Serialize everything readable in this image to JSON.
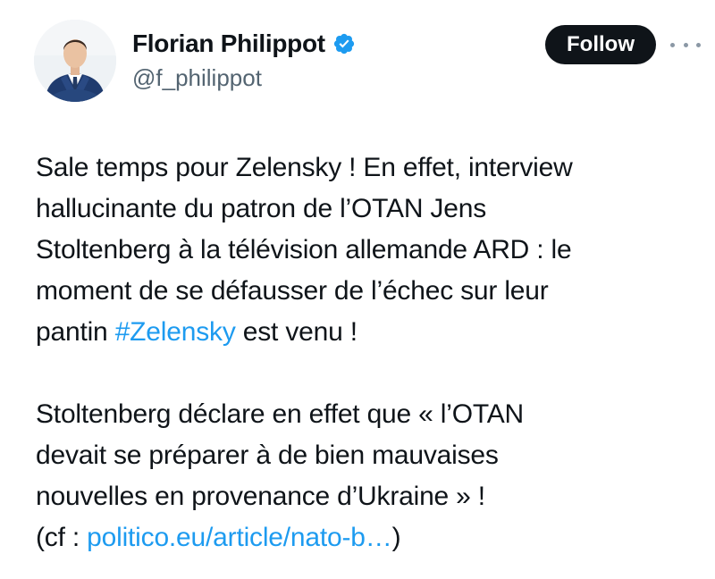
{
  "author": {
    "display_name": "Florian Philippot",
    "handle": "@f_philippot",
    "verified": true,
    "avatar_icon": "profile-photo"
  },
  "actions": {
    "follow_label": "Follow",
    "more_icon": "more-horizontal-icon"
  },
  "tweet": {
    "p1": {
      "line1": "Sale temps pour Zelensky ! En effet, interview",
      "line2": "hallucinante du patron de l’OTAN Jens",
      "line3": "Stoltenberg à la télévision allemande ARD : le",
      "line4": "moment de se défausser de l’échec sur leur",
      "line5_before": "pantin ",
      "hashtag": "#Zelensky",
      "line5_after": " est venu !"
    },
    "p2": {
      "line1": "Stoltenberg déclare en effet que « l’OTAN",
      "line2": "devait se préparer à de bien mauvaises",
      "line3": "nouvelles en provenance d’Ukraine » !",
      "line4_before": "(cf : ",
      "link": "politico.eu/article/nato-b…",
      "line4_after": ")"
    }
  },
  "colors": {
    "link": "#1d9bf0",
    "text": "#0f1419",
    "secondary": "#536471",
    "follow_bg": "#0f1419",
    "verified": "#1d9bf0"
  }
}
